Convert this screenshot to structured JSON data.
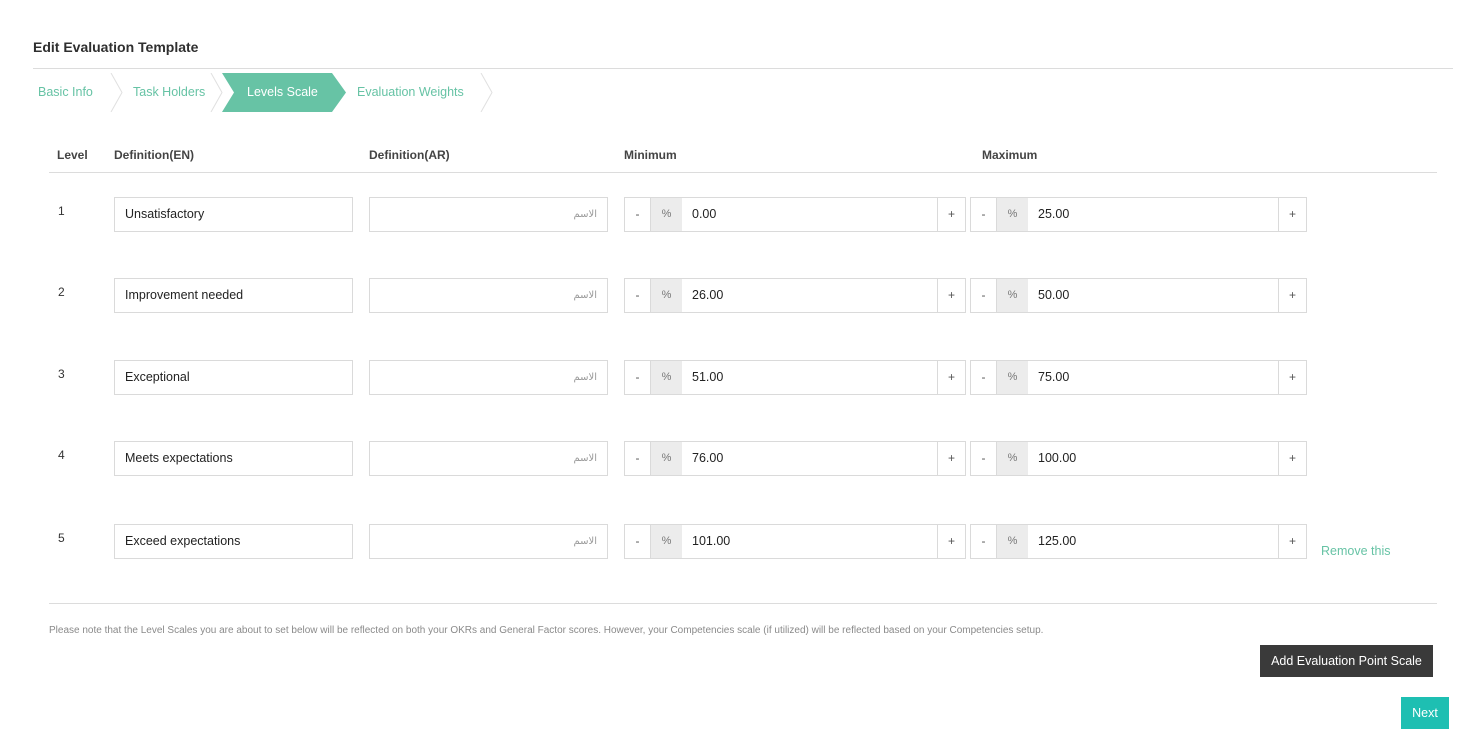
{
  "page": {
    "title": "Edit Evaluation Template"
  },
  "steps": [
    {
      "label": "Basic Info",
      "active": false
    },
    {
      "label": "Task Holders",
      "active": false
    },
    {
      "label": "Levels Scale",
      "active": true
    },
    {
      "label": "Evaluation Weights",
      "active": false
    }
  ],
  "table": {
    "headers": {
      "level": "Level",
      "def_en": "Definition(EN)",
      "def_ar": "Definition(AR)",
      "minimum": "Minimum",
      "maximum": "Maximum"
    },
    "ar_placeholder": "الاسم",
    "stepper": {
      "minus": "-",
      "percent": "%",
      "plus": "+"
    },
    "rows": [
      {
        "level": "1",
        "def_en": "Unsatisfactory",
        "min": "0.00",
        "max": "25.00"
      },
      {
        "level": "2",
        "def_en": "Improvement needed",
        "min": "26.00",
        "max": "50.00"
      },
      {
        "level": "3",
        "def_en": "Exceptional",
        "min": "51.00",
        "max": "75.00"
      },
      {
        "level": "4",
        "def_en": "Meets expectations",
        "min": "76.00",
        "max": "100.00"
      },
      {
        "level": "5",
        "def_en": "Exceed expectations",
        "min": "101.00",
        "max": "125.00"
      }
    ],
    "remove_label": "Remove this"
  },
  "note": "Please note that the Level Scales you are about to set below will be reflected on both your OKRs and General Factor scores. However, your Competencies scale (if utilized) will be reflected based on your Competencies setup.",
  "buttons": {
    "add_scale": "Add Evaluation Point Scale",
    "next": "Next"
  },
  "colors": {
    "accent": "#67c3a5",
    "next_button": "#1ebfb2",
    "dark_button": "#3a3a3a"
  }
}
